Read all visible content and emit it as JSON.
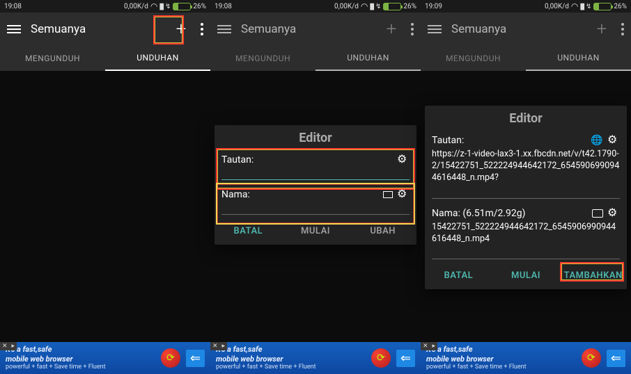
{
  "status": {
    "time1": "19:08",
    "time2": "19:08",
    "time3": "19:09",
    "net": "0,00K/d",
    "battery": "26%"
  },
  "app": {
    "title": "Semuanya",
    "tab_left": "MENGUNDUH",
    "tab_right": "UNDUHAN"
  },
  "editor_empty": {
    "heading": "Editor",
    "link_label": "Tautan:",
    "name_label": "Nama:",
    "btn_cancel": "BATAL",
    "btn_start": "MULAI",
    "btn_edit": "UBAH"
  },
  "editor_filled": {
    "heading": "Editor",
    "link_label": "Tautan:",
    "link_value": "https://z-1-video-lax3-1.xx.fbcdn.net/v/t42.1790-2/15422751_522224944642172_6545906990944616448_n.mp4?",
    "name_label": "Nama: (6.51m/2.92g)",
    "name_value": "15422751_522224944642172_6545906990944616448_n.mp4",
    "btn_cancel": "BATAL",
    "btn_start": "MULAI",
    "btn_add": "TAMBAHKAN"
  },
  "ad": {
    "line1": "It's a fast,safe",
    "line2": "mobile web browser",
    "sub": "powerful + fast + Save time + Fluent"
  }
}
